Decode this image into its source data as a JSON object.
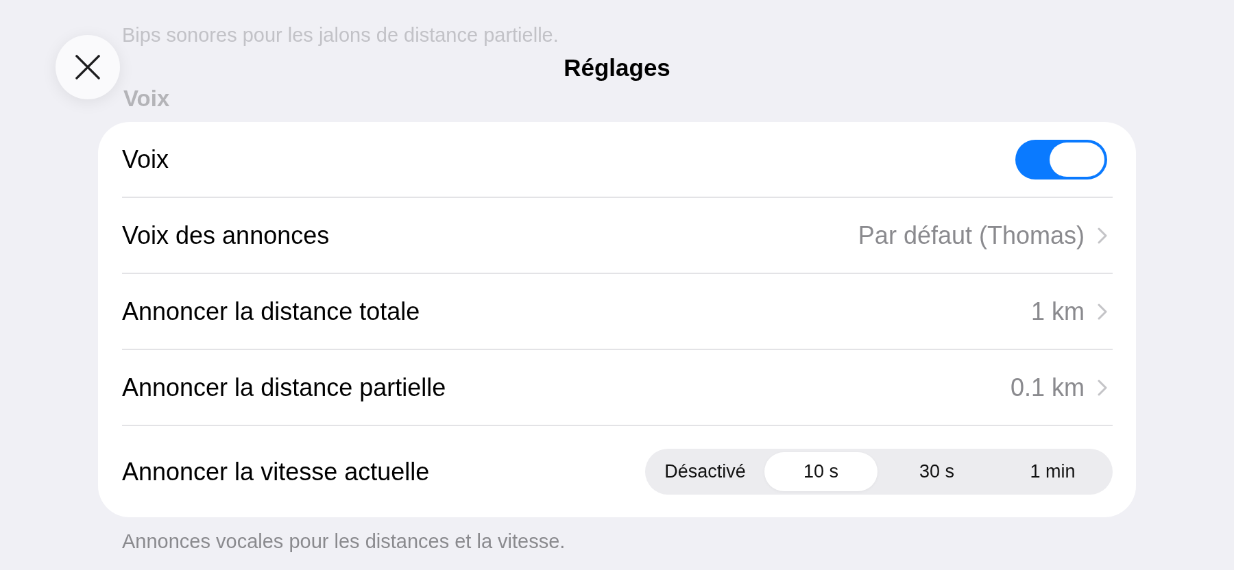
{
  "background_content": {
    "description": "Bips sonores pour les jalons de distance partielle.",
    "section_title": "Voix"
  },
  "header": {
    "title": "Réglages"
  },
  "settings": {
    "rows": [
      {
        "kind": "toggle",
        "label": "Voix",
        "on": true
      },
      {
        "kind": "link",
        "label": "Voix des annonces",
        "value": "Par défaut (Thomas)"
      },
      {
        "kind": "link",
        "label": "Annoncer la distance totale",
        "value": "1 km"
      },
      {
        "kind": "link",
        "label": "Annoncer la distance partielle",
        "value": "0.1 km"
      },
      {
        "kind": "segmented",
        "label": "Annoncer la vitesse actuelle",
        "options": [
          {
            "label": "Désactivé",
            "selected": false
          },
          {
            "label": "10 s",
            "selected": true
          },
          {
            "label": "30 s",
            "selected": false
          },
          {
            "label": "1 min",
            "selected": false
          }
        ]
      }
    ],
    "footer": "Annonces vocales pour les distances et la vitesse."
  }
}
